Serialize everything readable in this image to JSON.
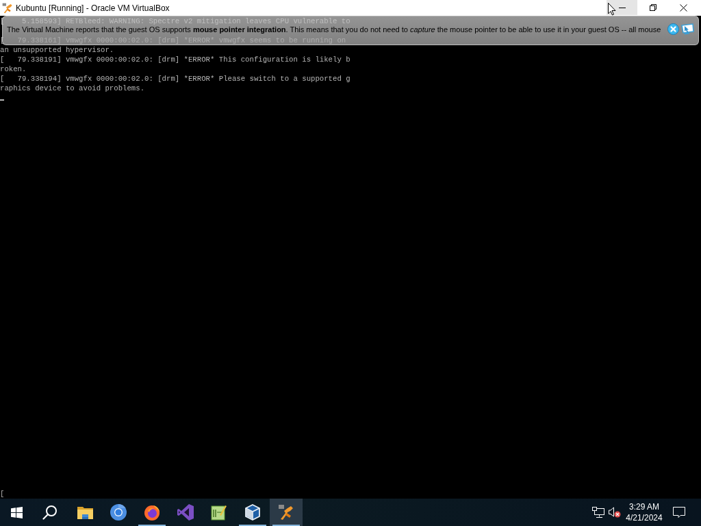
{
  "window": {
    "title": "Kubuntu [Running] - Oracle VM VirtualBox",
    "controls": [
      {
        "kind": "minimize",
        "hovered": true
      },
      {
        "kind": "restore",
        "hovered": false
      },
      {
        "kind": "close",
        "hovered": false
      }
    ]
  },
  "banner": {
    "message": "The Virtual Machine reports that the guest OS supports **mouse pointer integration**. This means that you do not need to *capture* the mouse pointer to be able to use it in your guest OS -- all mouse",
    "buttons": [
      {
        "kind": "close"
      },
      {
        "kind": "pointer"
      }
    ]
  },
  "console": {
    "lines_under_banner": [
      "[    5.158593] RETBleed: WARNING: Spectre v2 mitigation leaves CPU vulnerable to",
      "[   79.338161] vmwgfx 0000:00:02.0: [drm] *ERROR* vmwgfx seems to be running on"
    ],
    "lines": [
      "an unsupported hypervisor.",
      "[   79.338191] vmwgfx 0000:00:02.0: [drm] *ERROR* This configuration is likely b",
      "roken.",
      "[   79.338194] vmwgfx 0000:00:02.0: [drm] *ERROR* Please switch to a supported g",
      "raphics device to avoid problems."
    ],
    "last_line": "["
  },
  "taskbar": {
    "apps": [
      {
        "kind": "explorer",
        "running": false,
        "selected": false
      },
      {
        "kind": "chromium",
        "running": false,
        "selected": false
      },
      {
        "kind": "firefox",
        "running": true,
        "selected": false
      },
      {
        "kind": "studio",
        "running": false,
        "selected": false
      },
      {
        "kind": "notepad",
        "running": false,
        "selected": false
      },
      {
        "kind": "virtualbox",
        "running": true,
        "selected": false
      },
      {
        "kind": "machine",
        "running": true,
        "selected": true
      }
    ],
    "tray": {
      "volume_muted": true,
      "time": "3:29 AM",
      "date": "4/21/2024"
    }
  }
}
